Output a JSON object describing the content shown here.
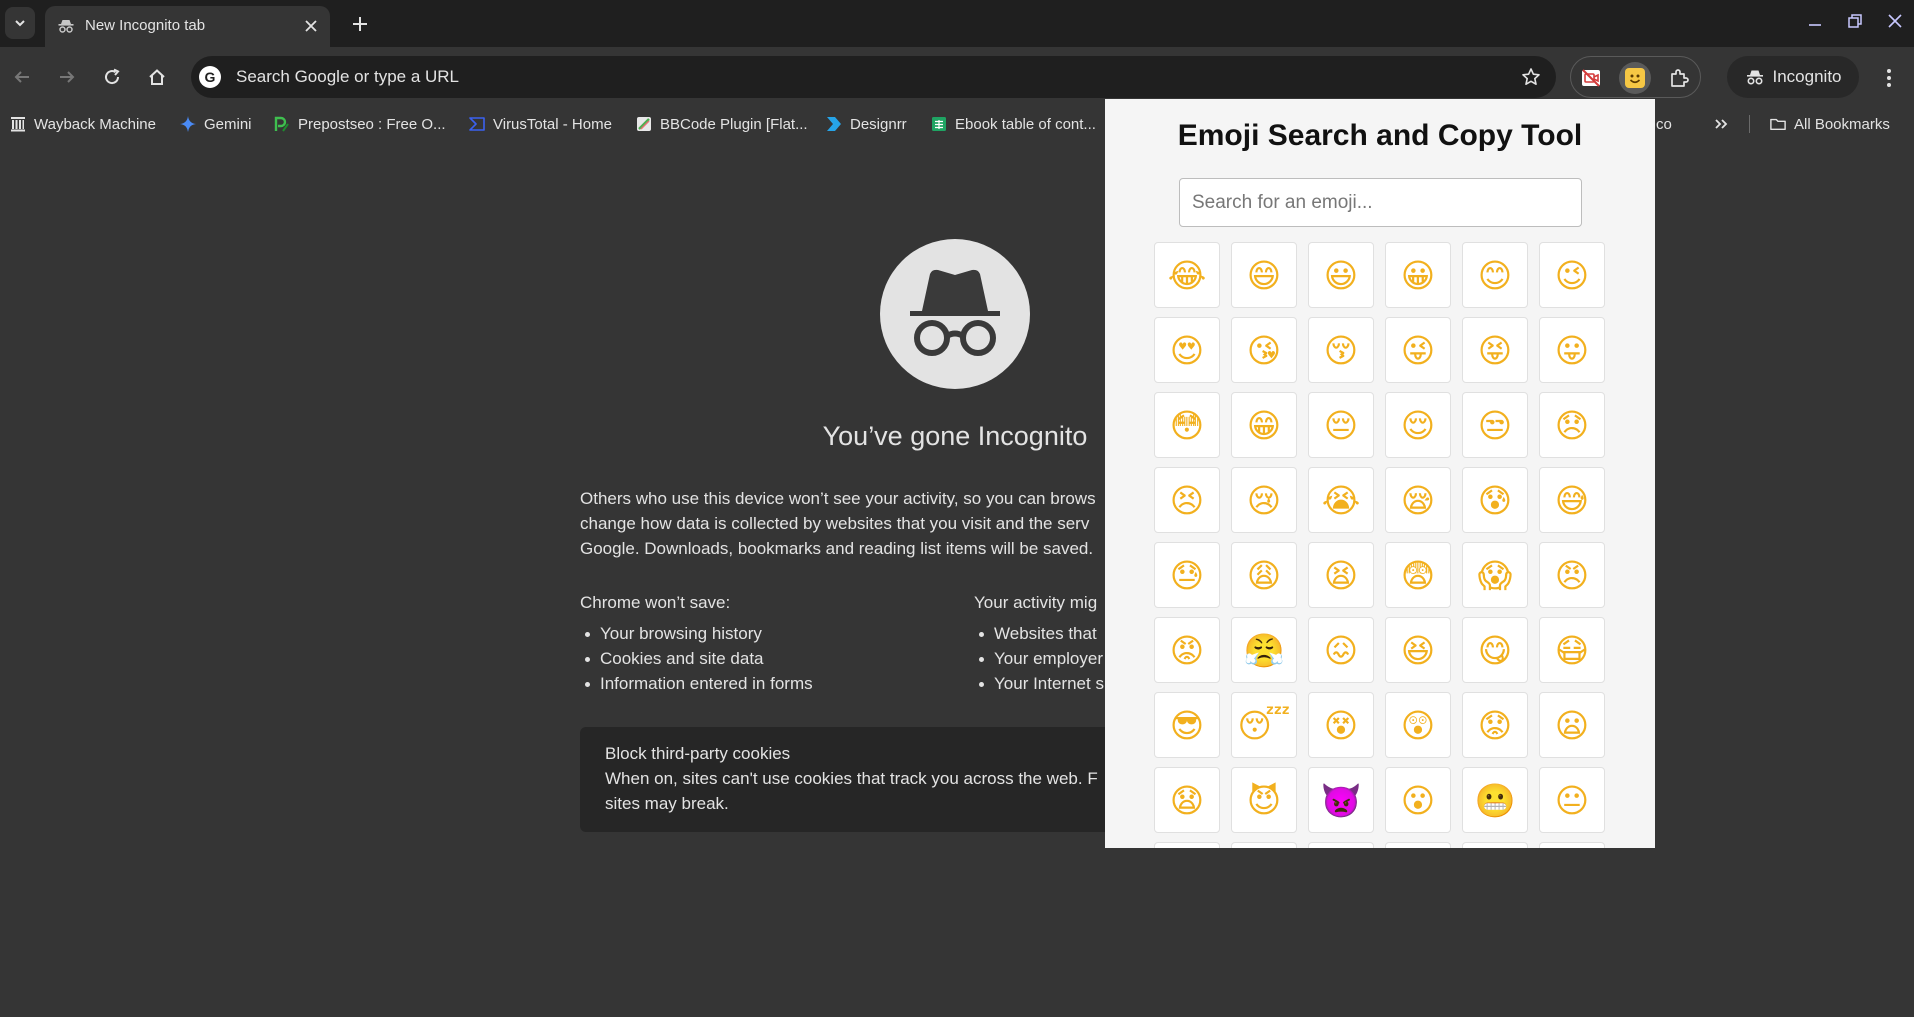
{
  "browser": {
    "tab": {
      "title": "New Incognito tab",
      "icon": "incognito-icon"
    },
    "omnibox": {
      "placeholder": "Search Google or type a URL",
      "icon": "google-g-icon",
      "g_letter": "G"
    },
    "profile_label": "Incognito",
    "extensions": [
      {
        "name": "no-camera-extension-icon"
      },
      {
        "name": "emoji-extension-icon"
      },
      {
        "name": "puzzle-icon"
      }
    ]
  },
  "bookmarks": {
    "items": [
      {
        "label": "Wayback Machine",
        "icon": "wayback-icon"
      },
      {
        "label": "Gemini",
        "icon": "gemini-icon"
      },
      {
        "label": "Prepostseo : Free O...",
        "icon": "prepostseo-icon"
      },
      {
        "label": "VirusTotal - Home",
        "icon": "virustotal-icon"
      },
      {
        "label": "BBCode Plugin [Flat...",
        "icon": "bbcode-icon"
      },
      {
        "label": "Designrr",
        "icon": "designrr-icon"
      },
      {
        "label": "Ebook table of cont...",
        "icon": "sheets-icon"
      }
    ],
    "partial_label": "co",
    "all_bookmarks_label": "All Bookmarks"
  },
  "ntp": {
    "title": "You’ve gone Incognito",
    "para_lines": [
      "Others who use this device won’t see your activity, so you can brows",
      "change how data is collected by websites that you visit and the serv",
      "Google. Downloads, bookmarks and reading list items will be saved."
    ],
    "wont_save": {
      "heading": "Chrome won’t save:",
      "items": [
        "Your browsing history",
        "Cookies and site data",
        "Information entered in forms"
      ]
    },
    "might_see": {
      "heading": "Your activity mig",
      "items": [
        "Websites that",
        "Your employer",
        "Your Internet s"
      ]
    },
    "cookies": {
      "title": "Block third-party cookies",
      "line1": "When on, sites can't use cookies that track you across the web. F",
      "line2": "sites may break."
    }
  },
  "popup": {
    "title": "Emoji Search and Copy Tool",
    "search_placeholder": "Search for an emoji...",
    "emojis": [
      "😂",
      "😄",
      "😃",
      "😀",
      "😊",
      "😉",
      "😍",
      "😘",
      "😚",
      "😜",
      "😝",
      "😛",
      "😳",
      "😁",
      "😔",
      "😌",
      "😒",
      "😞",
      "😣",
      "😢",
      "😭",
      "😪",
      "😰",
      "😅",
      "😓",
      "😩",
      "😫",
      "😨",
      "😱",
      "😠",
      "😡",
      "😤",
      "😖",
      "😆",
      "😋",
      "😷",
      "😎",
      "😴",
      "😵",
      "😲",
      "😟",
      "😦",
      "😧",
      "😈",
      "👿",
      "😮",
      "😬",
      "😐",
      "",
      "",
      "",
      "",
      "",
      ""
    ]
  }
}
